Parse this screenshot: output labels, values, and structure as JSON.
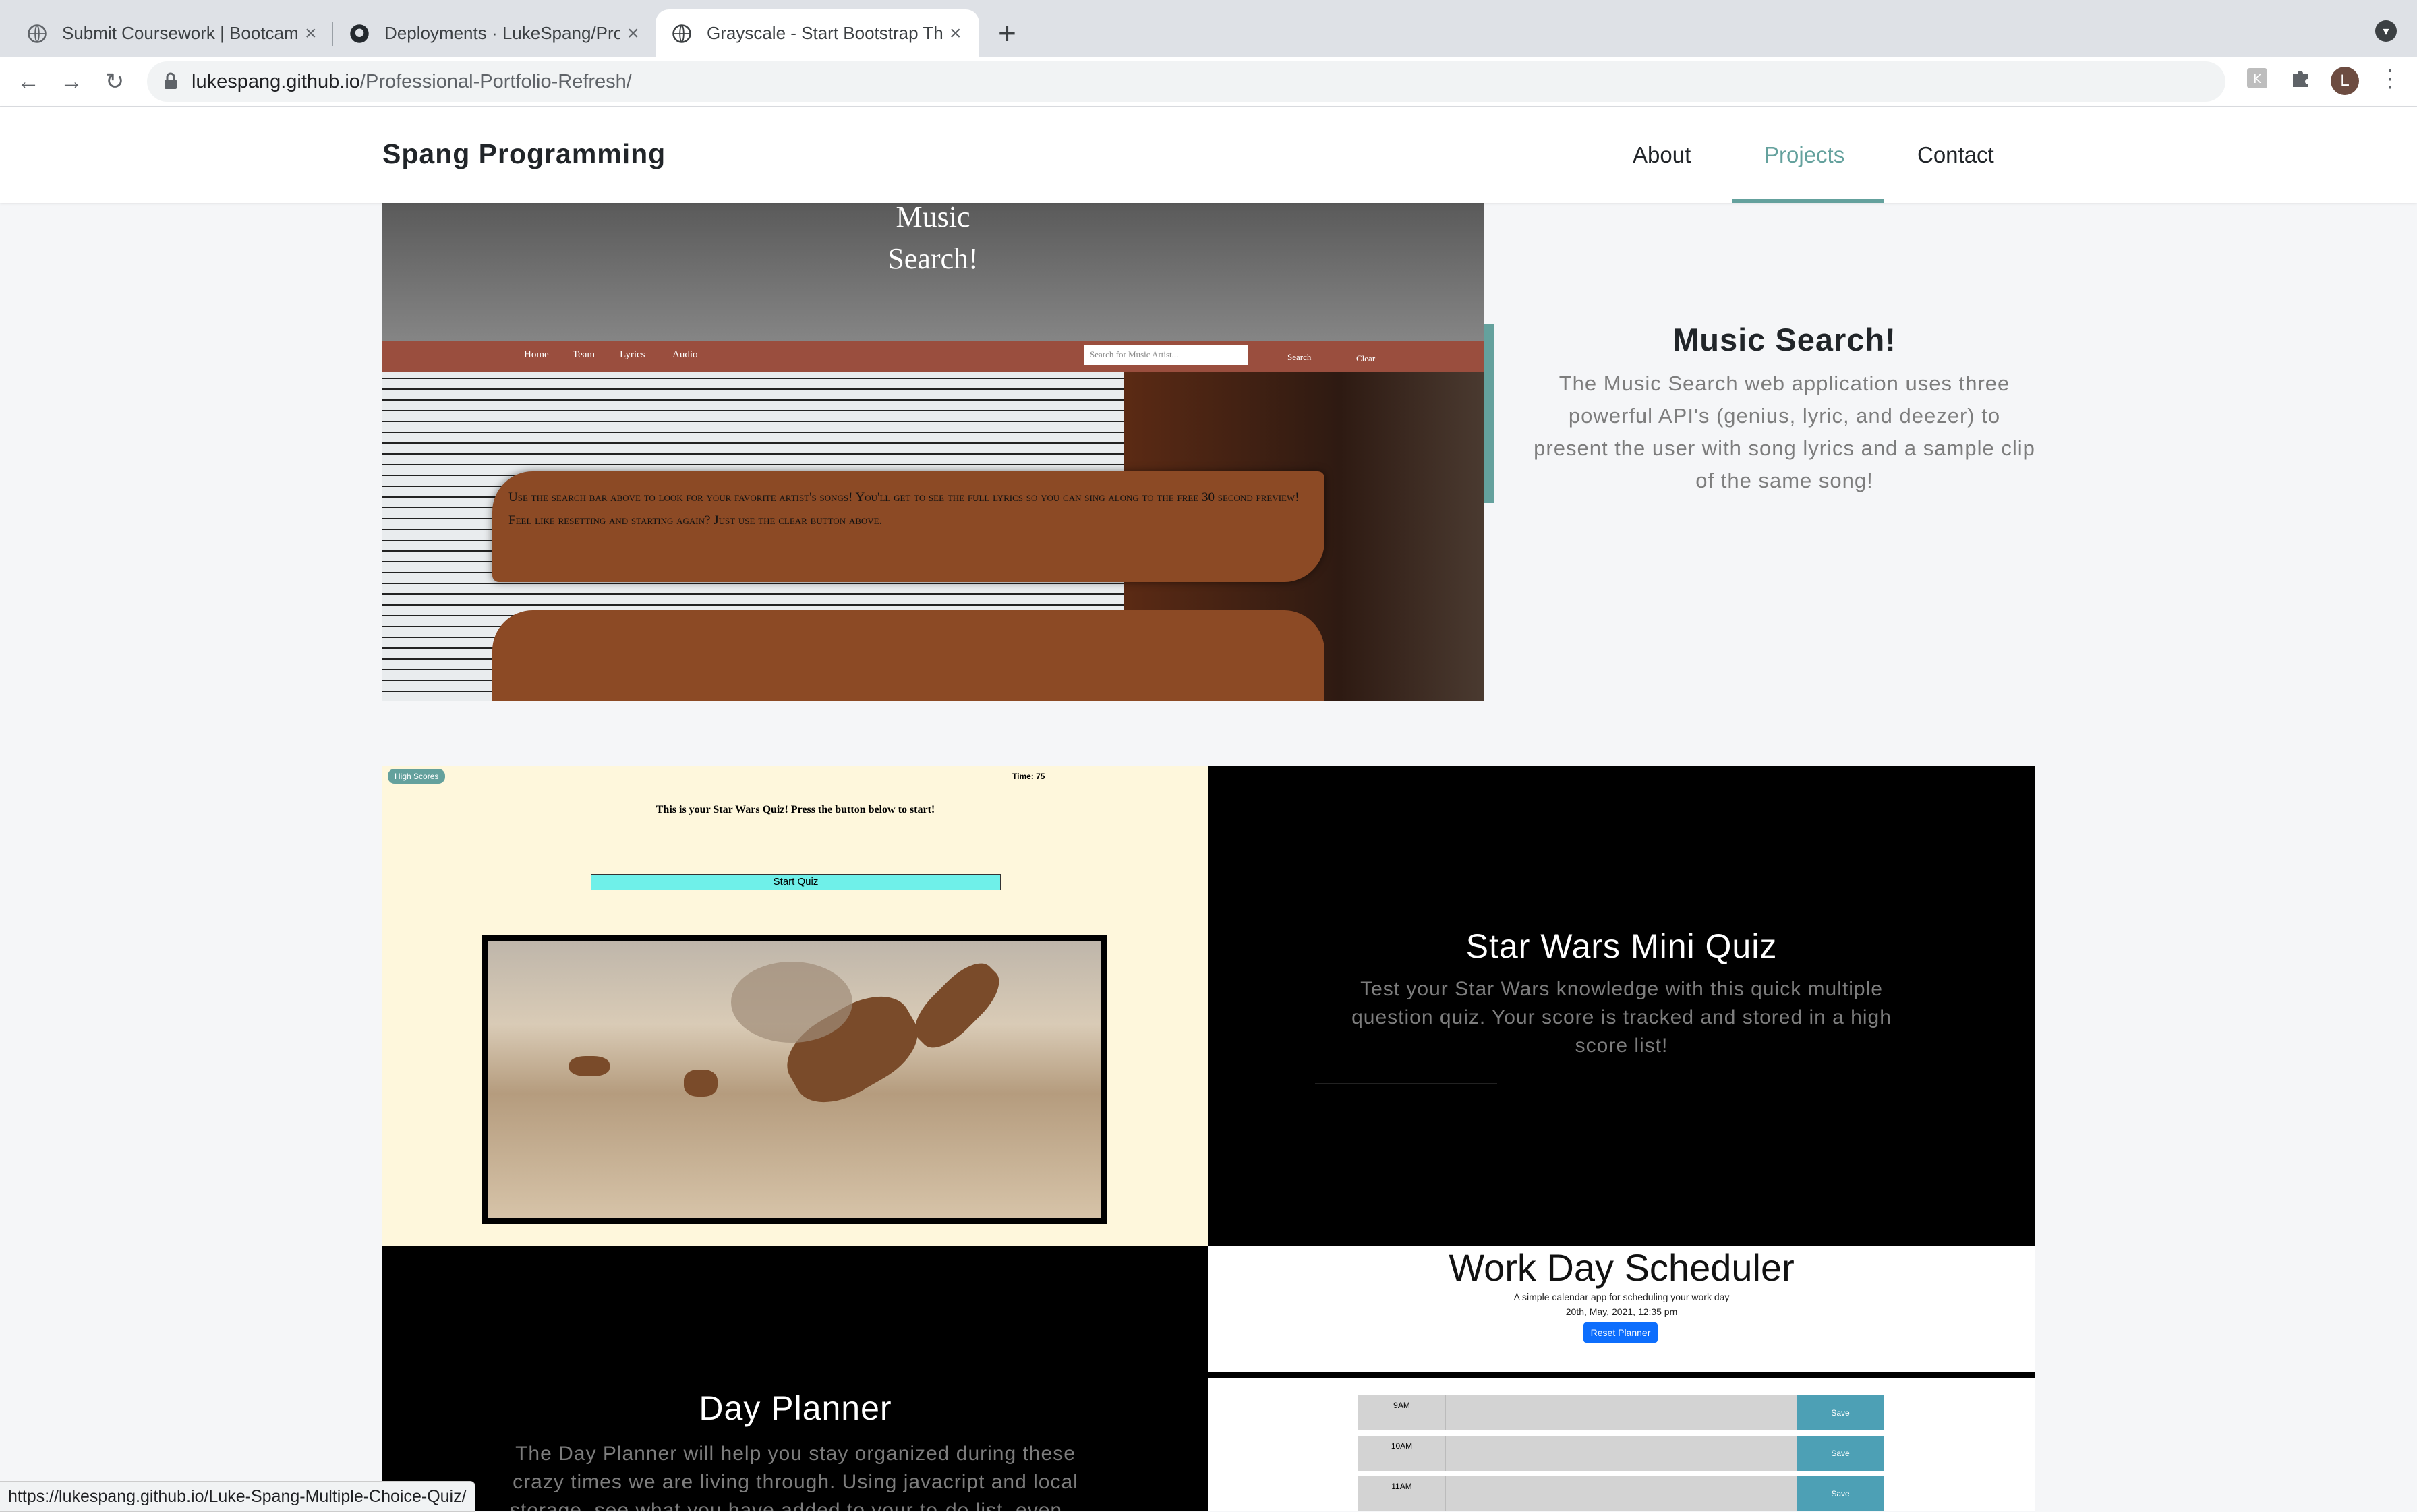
{
  "browser": {
    "tabs": [
      {
        "title": "Submit Coursework | Bootcamp",
        "icon": "globe-icon"
      },
      {
        "title": "Deployments · LukeSpang/Prof",
        "icon": "github-icon"
      },
      {
        "title": "Grayscale - Start Bootstrap Th",
        "icon": "globe-icon"
      }
    ],
    "url_domain": "lukespang.github.io",
    "url_path": "/Professional-Portfolio-Refresh/",
    "avatar_letter": "L",
    "status_url": "https://lukespang.github.io/Luke-Spang-Multiple-Choice-Quiz/"
  },
  "site": {
    "brand": "Spang Programming",
    "nav": [
      "About",
      "Projects",
      "Contact"
    ],
    "active_nav": "Projects",
    "accent": "#64a19d"
  },
  "projects": {
    "music": {
      "screenshot_title": "Music\nSearch!",
      "nav": [
        "Home",
        "Team",
        "Lyrics",
        "Audio"
      ],
      "search_placeholder": "Search for Music Artist...",
      "search_btn": "Search",
      "clear_btn": "Clear",
      "box_text": "Use the search bar above to look for your favorite artist's songs! You'll get to see the full lyrics so you can sing along to the free 30 second preview! Feel like resetting and starting again? Just use the clear button above.",
      "title": "Music Search!",
      "description": "The Music Search web application uses three powerful API's (genius, lyric, and deezer) to present the user with song lyrics and a sample clip of the same song!"
    },
    "starwars": {
      "badge": "High Scores",
      "time": "Time: 75",
      "prompt": "This is your Star Wars Quiz! Press the button below to start!",
      "start_btn": "Start Quiz",
      "title": "Star Wars Mini Quiz",
      "description": "Test your Star Wars knowledge with this quick multiple question quiz. Your score is tracked and stored in a high score list!"
    },
    "dayplanner": {
      "title": "Day Planner",
      "description": "The Day Planner will help you stay organized during these crazy times we are living through. Using javacript and local storage, see what you have added to your to-do list, even..."
    },
    "scheduler": {
      "title": "Work Day Scheduler",
      "subtitle": "A simple calendar app for scheduling your work day",
      "date": "20th, May, 2021, 12:35 pm",
      "reset_btn": "Reset Planner",
      "rows": [
        {
          "hour": "9AM",
          "save": "Save"
        },
        {
          "hour": "10AM",
          "save": "Save"
        },
        {
          "hour": "11AM",
          "save": "Save"
        }
      ]
    }
  }
}
